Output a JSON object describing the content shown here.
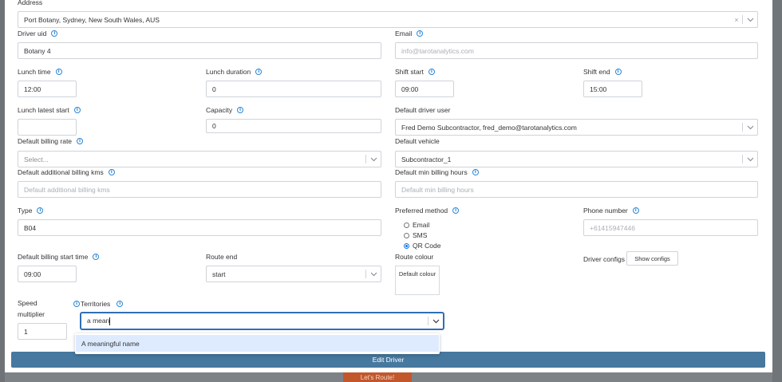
{
  "background": {
    "button_label": "Let's Route!"
  },
  "form": {
    "address": {
      "label": "Address",
      "value": "Port Botany, Sydney, New South Wales, AUS",
      "clear": "×"
    },
    "driver_uid": {
      "label": "Driver uid",
      "value": "Botany 4"
    },
    "email": {
      "label": "Email",
      "placeholder": "info@tarotanalytics.com"
    },
    "lunch_time": {
      "label": "Lunch time",
      "value": "12:00"
    },
    "lunch_duration": {
      "label": "Lunch duration",
      "value": "0"
    },
    "shift_start": {
      "label": "Shift start",
      "value": "09:00"
    },
    "shift_end": {
      "label": "Shift end",
      "value": "15:00"
    },
    "lunch_latest_start": {
      "label": "Lunch latest start",
      "value": ""
    },
    "capacity": {
      "label": "Capacity",
      "value": "0"
    },
    "default_driver_user": {
      "label": "Default driver user",
      "value": "Fred Demo Subcontractor, fred_demo@tarotanalytics.com"
    },
    "default_billing_rate": {
      "label": "Default billing rate",
      "placeholder": "Select..."
    },
    "default_vehicle": {
      "label": "Default vehicle",
      "value": "Subcontractor_1"
    },
    "default_additional_billing_kms": {
      "label": "Default additional billing kms",
      "placeholder": "Default additional billing kms"
    },
    "default_min_billing_hours": {
      "label": "Default min billing hours",
      "placeholder": "Default min billing hours"
    },
    "type": {
      "label": "Type",
      "value": "B04"
    },
    "preferred_method": {
      "label": "Preferred method",
      "options": [
        "Email",
        "SMS",
        "QR Code"
      ],
      "selected": "QR Code"
    },
    "phone_number": {
      "label": "Phone number",
      "placeholder": "+61415947446"
    },
    "default_billing_start_time": {
      "label": "Default billing start time",
      "value": "09:00"
    },
    "route_end": {
      "label": "Route end",
      "value": "start"
    },
    "route_colour": {
      "label": "Route colour",
      "button": "Default colour"
    },
    "driver_configs": {
      "label": "Driver configs",
      "button": "Show configs"
    },
    "speed_multiplier": {
      "label_line1": "Speed",
      "label_line2": "multiplier",
      "value": "1"
    },
    "territories": {
      "label": "Territories",
      "input_value": "a mean",
      "options": [
        "A meaningful name"
      ]
    },
    "submit_label": "Edit Driver"
  },
  "icons": {
    "info": "info-circle-icon",
    "chevron": "chevron-down-icon",
    "clear": "close-icon"
  },
  "colors": {
    "accent": "#47789f",
    "info": "#2a86d6",
    "focus": "#2f6fb5",
    "option_highlight": "#deebff",
    "background_button": "#c2572b"
  }
}
